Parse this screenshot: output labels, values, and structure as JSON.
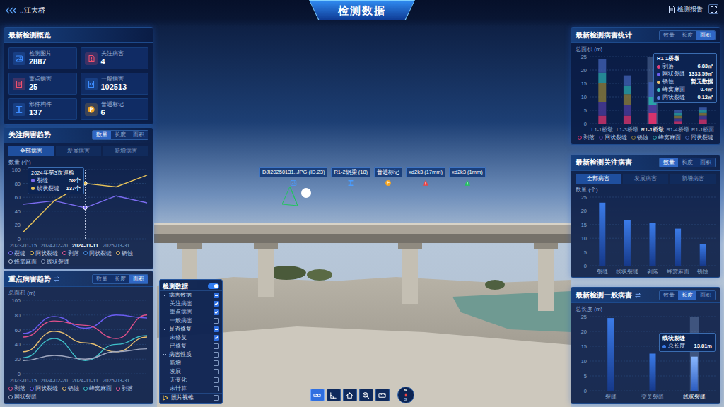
{
  "header": {
    "bridge": "..江大桥",
    "title": "检测数据",
    "report": "检测报告"
  },
  "overview": {
    "title": "最新检测概览",
    "stats": [
      {
        "label": "检测图片",
        "value": "2887",
        "kind": "image",
        "color": "#3d8bfd"
      },
      {
        "label": "关注病害",
        "value": "4",
        "kind": "focus",
        "color": "#f0506e"
      },
      {
        "label": "重点病害",
        "value": "25",
        "kind": "key",
        "color": "#f0506e"
      },
      {
        "label": "一般病害",
        "value": "102513",
        "kind": "general",
        "color": "#3d8bfd"
      },
      {
        "label": "部件构件",
        "value": "137",
        "kind": "member",
        "color": "#3d8bfd"
      },
      {
        "label": "普通标记",
        "value": "6",
        "kind": "mark",
        "color": "#f5a623"
      }
    ]
  },
  "focus_trend": {
    "title": "关注病害趋势",
    "tabs": [
      {
        "label": "数量",
        "selected": true
      },
      {
        "label": "长度",
        "selected": false
      },
      {
        "label": "面积",
        "selected": false
      }
    ],
    "subtabs": [
      {
        "label": "全部病害",
        "selected": true
      },
      {
        "label": "发展病害",
        "selected": false
      },
      {
        "label": "新增病害",
        "selected": false
      }
    ],
    "y_label": "数量 (个)",
    "y_ticks": [
      "0",
      "20",
      "40",
      "60",
      "80",
      "100"
    ],
    "x_ticks": [
      "2023-01-15",
      "2024-02-20",
      "2024-11-11",
      "2025-03-31"
    ],
    "series": [
      {
        "color": "#7b6cf0",
        "values": [
          50,
          55,
          45,
          62,
          52
        ]
      },
      {
        "color": "#e8c35a",
        "values": [
          10,
          55,
          80,
          75,
          92
        ]
      }
    ],
    "cursor": 2,
    "tooltip": {
      "title": "2024年第3次巡检",
      "rows": [
        {
          "name": "裂缝",
          "value": "58个",
          "color": "#7b6cf0"
        },
        {
          "name": "线状裂缝",
          "value": "137个",
          "color": "#e8c35a"
        }
      ]
    },
    "legend": [
      {
        "name": "裂缝",
        "color": "#7b6cf0"
      },
      {
        "name": "网状裂缝",
        "color": "#e8c35a"
      },
      {
        "name": "剥落",
        "color": "#f0609a"
      },
      {
        "name": "网状裂缝",
        "color": "#4a90e2"
      },
      {
        "name": "锈蚀",
        "color": "#d9b26a"
      },
      {
        "name": "蜂窝麻面",
        "color": "#b8c4d8"
      },
      {
        "name": "线状裂缝",
        "color": "#8899bb"
      }
    ]
  },
  "key_trend": {
    "title": "重点病害趋势",
    "tabs": [
      {
        "label": "数量",
        "selected": false
      },
      {
        "label": "长度",
        "selected": false
      },
      {
        "label": "面积",
        "selected": true
      }
    ],
    "y_label": "总面积 (m)",
    "y_ticks": [
      "0",
      "20",
      "40",
      "60",
      "80",
      "100"
    ],
    "x_ticks": [
      "2023-01-15",
      "2024-02-20",
      "2024-11-11",
      "2025-03-31"
    ],
    "series": [
      {
        "color": "#6a5cf0",
        "values": [
          55,
          78,
          62,
          80,
          76
        ]
      },
      {
        "color": "#e0508a",
        "values": [
          50,
          72,
          66,
          48,
          80
        ]
      },
      {
        "color": "#e8c070",
        "values": [
          30,
          58,
          42,
          30,
          50
        ]
      },
      {
        "color": "#3fc1c9",
        "values": [
          22,
          48,
          18,
          40,
          52
        ]
      },
      {
        "color": "#a0a8c0",
        "values": [
          18,
          25,
          20,
          30,
          34
        ]
      }
    ],
    "legend": [
      {
        "name": "剥落",
        "color": "#e0508a"
      },
      {
        "name": "网状裂缝",
        "color": "#6a5cf0"
      },
      {
        "name": "锈蚀",
        "color": "#e8c070"
      },
      {
        "name": "蜂窝麻面",
        "color": "#3fc1c9"
      },
      {
        "name": "剥落",
        "color": "#f0609a"
      },
      {
        "name": "网状裂缝",
        "color": "#a0a8c0"
      }
    ]
  },
  "layers": {
    "title": "检测数据",
    "on": true,
    "groups": [
      {
        "label": "病害数据",
        "expanded": true,
        "checked": false,
        "partial": true,
        "items": [
          {
            "label": "关注病害",
            "checked": true
          },
          {
            "label": "重点病害",
            "checked": true
          },
          {
            "label": "一般病害",
            "checked": false
          }
        ]
      },
      {
        "label": "是否修复",
        "expanded": true,
        "checked": false,
        "partial": true,
        "items": [
          {
            "label": "未修复",
            "checked": true
          },
          {
            "label": "已修复",
            "checked": false
          }
        ]
      },
      {
        "label": "病害性质",
        "expanded": true,
        "checked": false,
        "partial": false,
        "items": [
          {
            "label": "新增",
            "checked": false
          },
          {
            "label": "发展",
            "checked": false
          },
          {
            "label": "无变化",
            "checked": false
          },
          {
            "label": "未计算",
            "checked": false
          }
        ]
      }
    ],
    "footer": {
      "label": "照片视锥",
      "checked": false
    }
  },
  "scene": {
    "markers": [
      {
        "label": "DJI20250131..JPG (ID.23)",
        "kind": "photo"
      },
      {
        "label": "R1-2钢梁 (18)",
        "kind": "member"
      },
      {
        "label": "普通标记",
        "kind": "mark"
      },
      {
        "label": "xd2k3 (17mm)",
        "kind": "danger"
      },
      {
        "label": "xd2k3 (1mm)",
        "kind": "minor"
      }
    ]
  },
  "toolbar": {
    "tools": [
      {
        "kind": "measure",
        "selected": true
      },
      {
        "kind": "angle",
        "selected": false
      },
      {
        "kind": "home",
        "selected": false
      },
      {
        "kind": "zoom",
        "selected": false
      },
      {
        "kind": "keyboard",
        "selected": false
      }
    ],
    "compass": {
      "n": "N",
      "s": "S"
    }
  },
  "defect_stats": {
    "title": "最新检测病害统计",
    "tabs": [
      {
        "label": "数量",
        "selected": false
      },
      {
        "label": "长度",
        "selected": false
      },
      {
        "label": "面积",
        "selected": true
      }
    ],
    "y_label": "总面积 (m)",
    "y_ticks": [
      "0",
      "5",
      "10",
      "15",
      "20",
      "25"
    ],
    "series": [
      {
        "name": "剥落",
        "color": "#d6336c"
      },
      {
        "name": "网状裂缝",
        "color": "#4b3b9a"
      },
      {
        "name": "锈蚀",
        "color": "#8a7a3a"
      },
      {
        "name": "蜂窝麻面",
        "color": "#2aa3a8"
      },
      {
        "name": "同状裂缝",
        "color": "#3e5fb0"
      }
    ],
    "categories": [
      {
        "label": "L1-1桥墩",
        "selected": false,
        "values": [
          3,
          5,
          7,
          4,
          5
        ]
      },
      {
        "label": "L1-3桥墩",
        "selected": false,
        "values": [
          3,
          4,
          4,
          3,
          4
        ]
      },
      {
        "label": "R1-1桥墩",
        "selected": true,
        "values": [
          4,
          3,
          0,
          3,
          5.5
        ]
      },
      {
        "label": "R1-4桥墩",
        "selected": false,
        "values": [
          1,
          1,
          1,
          1,
          1
        ]
      },
      {
        "label": "R1-1桥面",
        "selected": false,
        "values": [
          1.5,
          1.5,
          1,
          1,
          1
        ]
      }
    ],
    "tooltip": {
      "title": "R1-1桥墩",
      "rows": [
        {
          "name": "剥落",
          "value": "6.83㎡",
          "color": "#e0407a"
        },
        {
          "name": "网状裂缝",
          "value": "1333.59㎡",
          "color": "#6a5cf0"
        },
        {
          "name": "锈蚀",
          "value": "暂无数据",
          "color": "#e8c070"
        },
        {
          "name": "蜂窝麻面",
          "value": "0.4㎡",
          "color": "#3fc1c9"
        },
        {
          "name": "同状裂缝",
          "value": "0.12㎡",
          "color": "#5b7fe0"
        }
      ]
    }
  },
  "focus_defects": {
    "title": "最新检测关注病害",
    "tabs": [
      {
        "label": "数量",
        "selected": true
      },
      {
        "label": "长度",
        "selected": false
      },
      {
        "label": "面积",
        "selected": false
      }
    ],
    "subtabs": [
      {
        "label": "全部病害",
        "selected": true
      },
      {
        "label": "发展病害",
        "selected": false
      },
      {
        "label": "新增病害",
        "selected": false
      }
    ],
    "y_label": "数量 (个)",
    "y_ticks": [
      "0",
      "5",
      "10",
      "15",
      "20",
      "25"
    ],
    "bars": [
      {
        "label": "裂缝",
        "value": 23
      },
      {
        "label": "线状裂缝",
        "value": 16.5
      },
      {
        "label": "剥落",
        "value": 15.5
      },
      {
        "label": "蜂窝麻面",
        "value": 13.5
      },
      {
        "label": "锈蚀",
        "value": 8
      }
    ]
  },
  "general_defects": {
    "title": "最新检测一般病害",
    "tabs": [
      {
        "label": "数量",
        "selected": false
      },
      {
        "label": "长度",
        "selected": true
      },
      {
        "label": "面积",
        "selected": false
      }
    ],
    "y_label": "总长度 (m)",
    "y_ticks": [
      "0",
      "5",
      "10",
      "15",
      "20",
      "25"
    ],
    "bars": [
      {
        "label": "裂缝",
        "value": 24.5,
        "selected": false
      },
      {
        "label": "交叉裂缝",
        "value": 12.5,
        "selected": false
      },
      {
        "label": "线状裂缝",
        "value": 11.5,
        "selected": true
      }
    ],
    "tooltip": {
      "title": "线状裂缝",
      "label": "总长度",
      "value": "13.81m",
      "color": "#3b7be8"
    }
  }
}
